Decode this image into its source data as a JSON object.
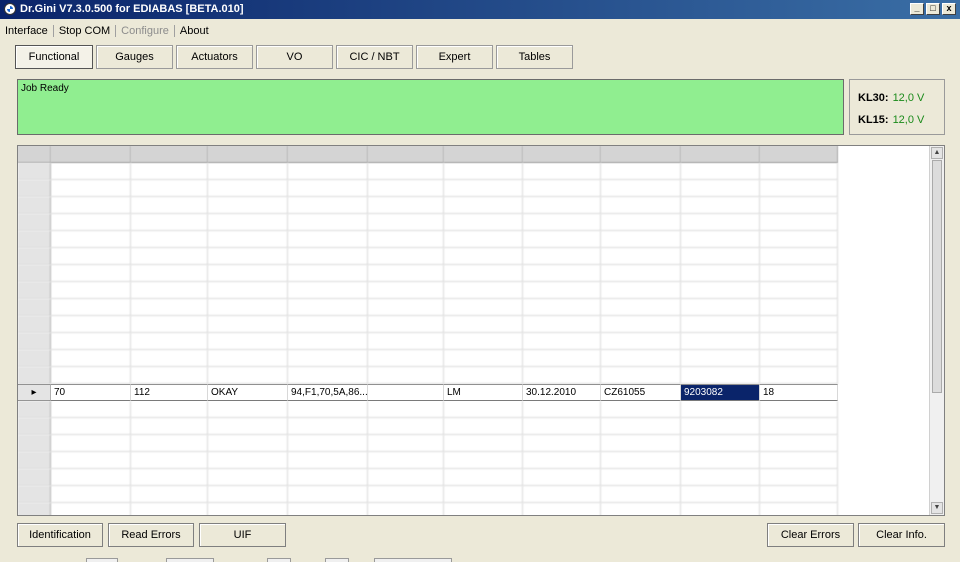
{
  "window": {
    "title": "Dr.Gini V7.3.0.500 for EDIABAS [BETA.010]",
    "app_icon": "bmw-roundel-icon",
    "minimize_glyph": "_",
    "maximize_glyph": "□",
    "close_glyph": "x"
  },
  "menu": [
    {
      "label": "Interface",
      "enabled": true
    },
    {
      "label": "Stop COM",
      "enabled": true
    },
    {
      "label": "Configure",
      "enabled": false
    },
    {
      "label": "About",
      "enabled": true
    }
  ],
  "tabs": [
    {
      "label": "Functional",
      "active": true
    },
    {
      "label": "Gauges",
      "active": false
    },
    {
      "label": "Actuators",
      "active": false
    },
    {
      "label": "VO",
      "active": false
    },
    {
      "label": "CIC / NBT",
      "active": false
    },
    {
      "label": "Expert",
      "active": false
    },
    {
      "label": "Tables",
      "active": false
    }
  ],
  "status": {
    "text": "Job Ready",
    "color": "#90ee90"
  },
  "kl": {
    "kl30_label": "KL30:",
    "kl30_value": "12,0 V",
    "kl15_label": "KL15:",
    "kl15_value": "12,0 V"
  },
  "table": {
    "columns": [
      "",
      "",
      "",
      "",
      "",
      "",
      "",
      "",
      "",
      ""
    ],
    "rows": [
      {
        "cells": [
          "",
          "",
          "",
          "",
          "",
          "",
          "",
          "",
          "",
          ""
        ],
        "blurred": true
      },
      {
        "cells": [
          "",
          "",
          "",
          "",
          "",
          "",
          "",
          "",
          "",
          ""
        ],
        "blurred": true
      },
      {
        "cells": [
          "",
          "",
          "",
          "",
          "",
          "",
          "",
          "",
          "",
          ""
        ],
        "blurred": true
      },
      {
        "cells": [
          "",
          "",
          "",
          "",
          "",
          "",
          "",
          "",
          "",
          ""
        ],
        "blurred": true
      },
      {
        "cells": [
          "",
          "",
          "",
          "",
          "",
          "",
          "",
          "",
          "",
          ""
        ],
        "blurred": true
      },
      {
        "cells": [
          "",
          "",
          "",
          "",
          "",
          "",
          "",
          "",
          "",
          ""
        ],
        "blurred": true
      },
      {
        "cells": [
          "",
          "",
          "",
          "",
          "",
          "",
          "",
          "",
          "",
          ""
        ],
        "blurred": true
      },
      {
        "cells": [
          "",
          "",
          "",
          "",
          "",
          "",
          "",
          "",
          "",
          ""
        ],
        "blurred": true
      },
      {
        "cells": [
          "",
          "",
          "",
          "",
          "",
          "",
          "",
          "",
          "",
          ""
        ],
        "blurred": true
      },
      {
        "cells": [
          "",
          "",
          "",
          "",
          "",
          "",
          "",
          "",
          "",
          ""
        ],
        "blurred": true
      },
      {
        "cells": [
          "",
          "",
          "",
          "",
          "",
          "",
          "",
          "",
          "",
          ""
        ],
        "blurred": true
      },
      {
        "cells": [
          "",
          "",
          "",
          "",
          "",
          "",
          "",
          "",
          "",
          ""
        ],
        "blurred": true
      },
      {
        "cells": [
          "",
          "",
          "",
          "",
          "",
          "",
          "",
          "",
          "",
          ""
        ],
        "blurred": true
      },
      {
        "cells": [
          "70",
          "112",
          "OKAY",
          "94,F1,70,5A,86...",
          "",
          "LM",
          "30.12.2010",
          "CZ61055",
          "9203082",
          "18"
        ],
        "blurred": false,
        "selected": true,
        "row_marker": "▸",
        "highlight_col": 8
      },
      {
        "cells": [
          "",
          "",
          "",
          "",
          "",
          "",
          "",
          "",
          "",
          ""
        ],
        "blurred": true
      },
      {
        "cells": [
          "",
          "",
          "",
          "",
          "",
          "",
          "",
          "",
          "",
          ""
        ],
        "blurred": true
      },
      {
        "cells": [
          "",
          "",
          "",
          "",
          "",
          "",
          "",
          "",
          "",
          ""
        ],
        "blurred": true
      },
      {
        "cells": [
          "",
          "",
          "",
          "",
          "",
          "",
          "",
          "",
          "",
          ""
        ],
        "blurred": true
      },
      {
        "cells": [
          "",
          "",
          "",
          "",
          "",
          "",
          "",
          "",
          "",
          ""
        ],
        "blurred": true
      },
      {
        "cells": [
          "",
          "",
          "",
          "",
          "",
          "",
          "",
          "",
          "",
          ""
        ],
        "blurred": true
      },
      {
        "cells": [
          "",
          "",
          "",
          "",
          "",
          "",
          "",
          "",
          "",
          ""
        ],
        "blurred": true
      }
    ]
  },
  "scrollbar": {
    "up_glyph": "▲",
    "down_glyph": "▼"
  },
  "buttons": {
    "identification": "Identification",
    "read_errors": "Read Errors",
    "uif": "UIF",
    "clear_errors": "Clear Errors",
    "clear_info": "Clear Info."
  }
}
